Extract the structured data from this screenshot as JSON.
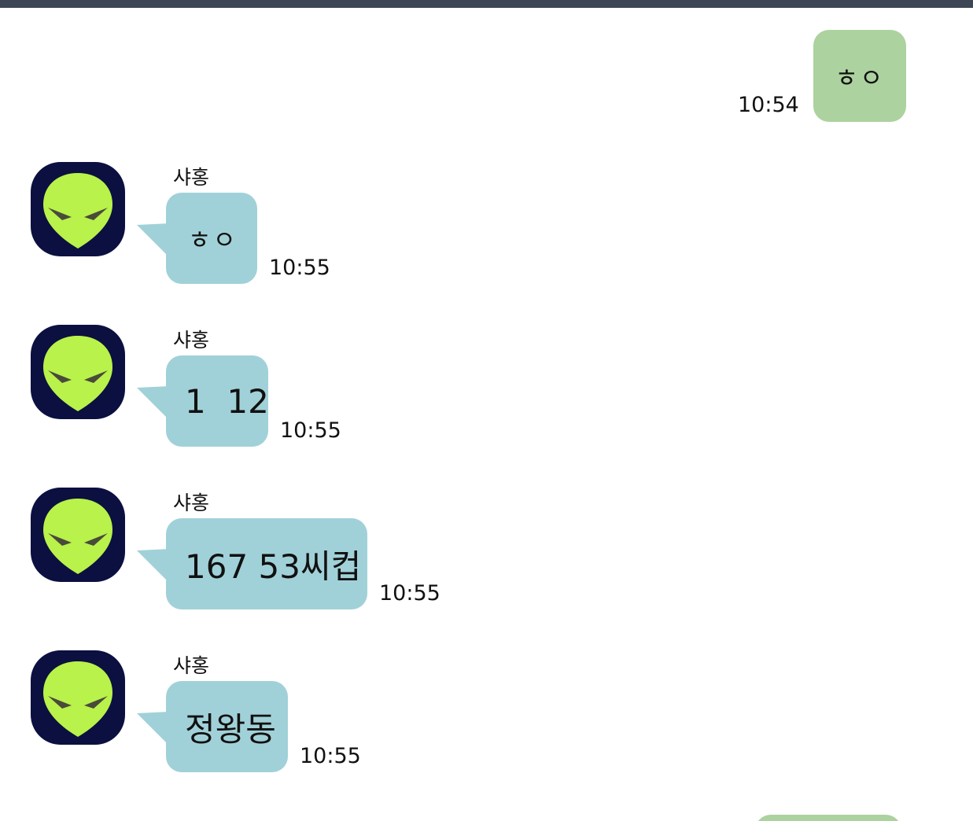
{
  "colors": {
    "top_bar": "#3c4655",
    "outgoing_bubble": "#acd29f",
    "incoming_bubble": "#a1d1d8",
    "avatar_bg": "#0b1040",
    "avatar_face": "#b8f24a"
  },
  "messages": [
    {
      "direction": "outgoing",
      "text": "ㅎㅇ",
      "time": "10:54"
    },
    {
      "direction": "incoming",
      "sender": "샤홍",
      "avatar_icon": "alien-icon",
      "text": "ㅎㅇ",
      "time": "10:55"
    },
    {
      "direction": "incoming",
      "sender": "샤홍",
      "avatar_icon": "alien-icon",
      "text": "1  12",
      "time": "10:55"
    },
    {
      "direction": "incoming",
      "sender": "샤홍",
      "avatar_icon": "alien-icon",
      "text": "167 53씨컵",
      "time": "10:55"
    },
    {
      "direction": "incoming",
      "sender": "샤홍",
      "avatar_icon": "alien-icon",
      "text": "정왕동",
      "time": "10:55"
    }
  ]
}
